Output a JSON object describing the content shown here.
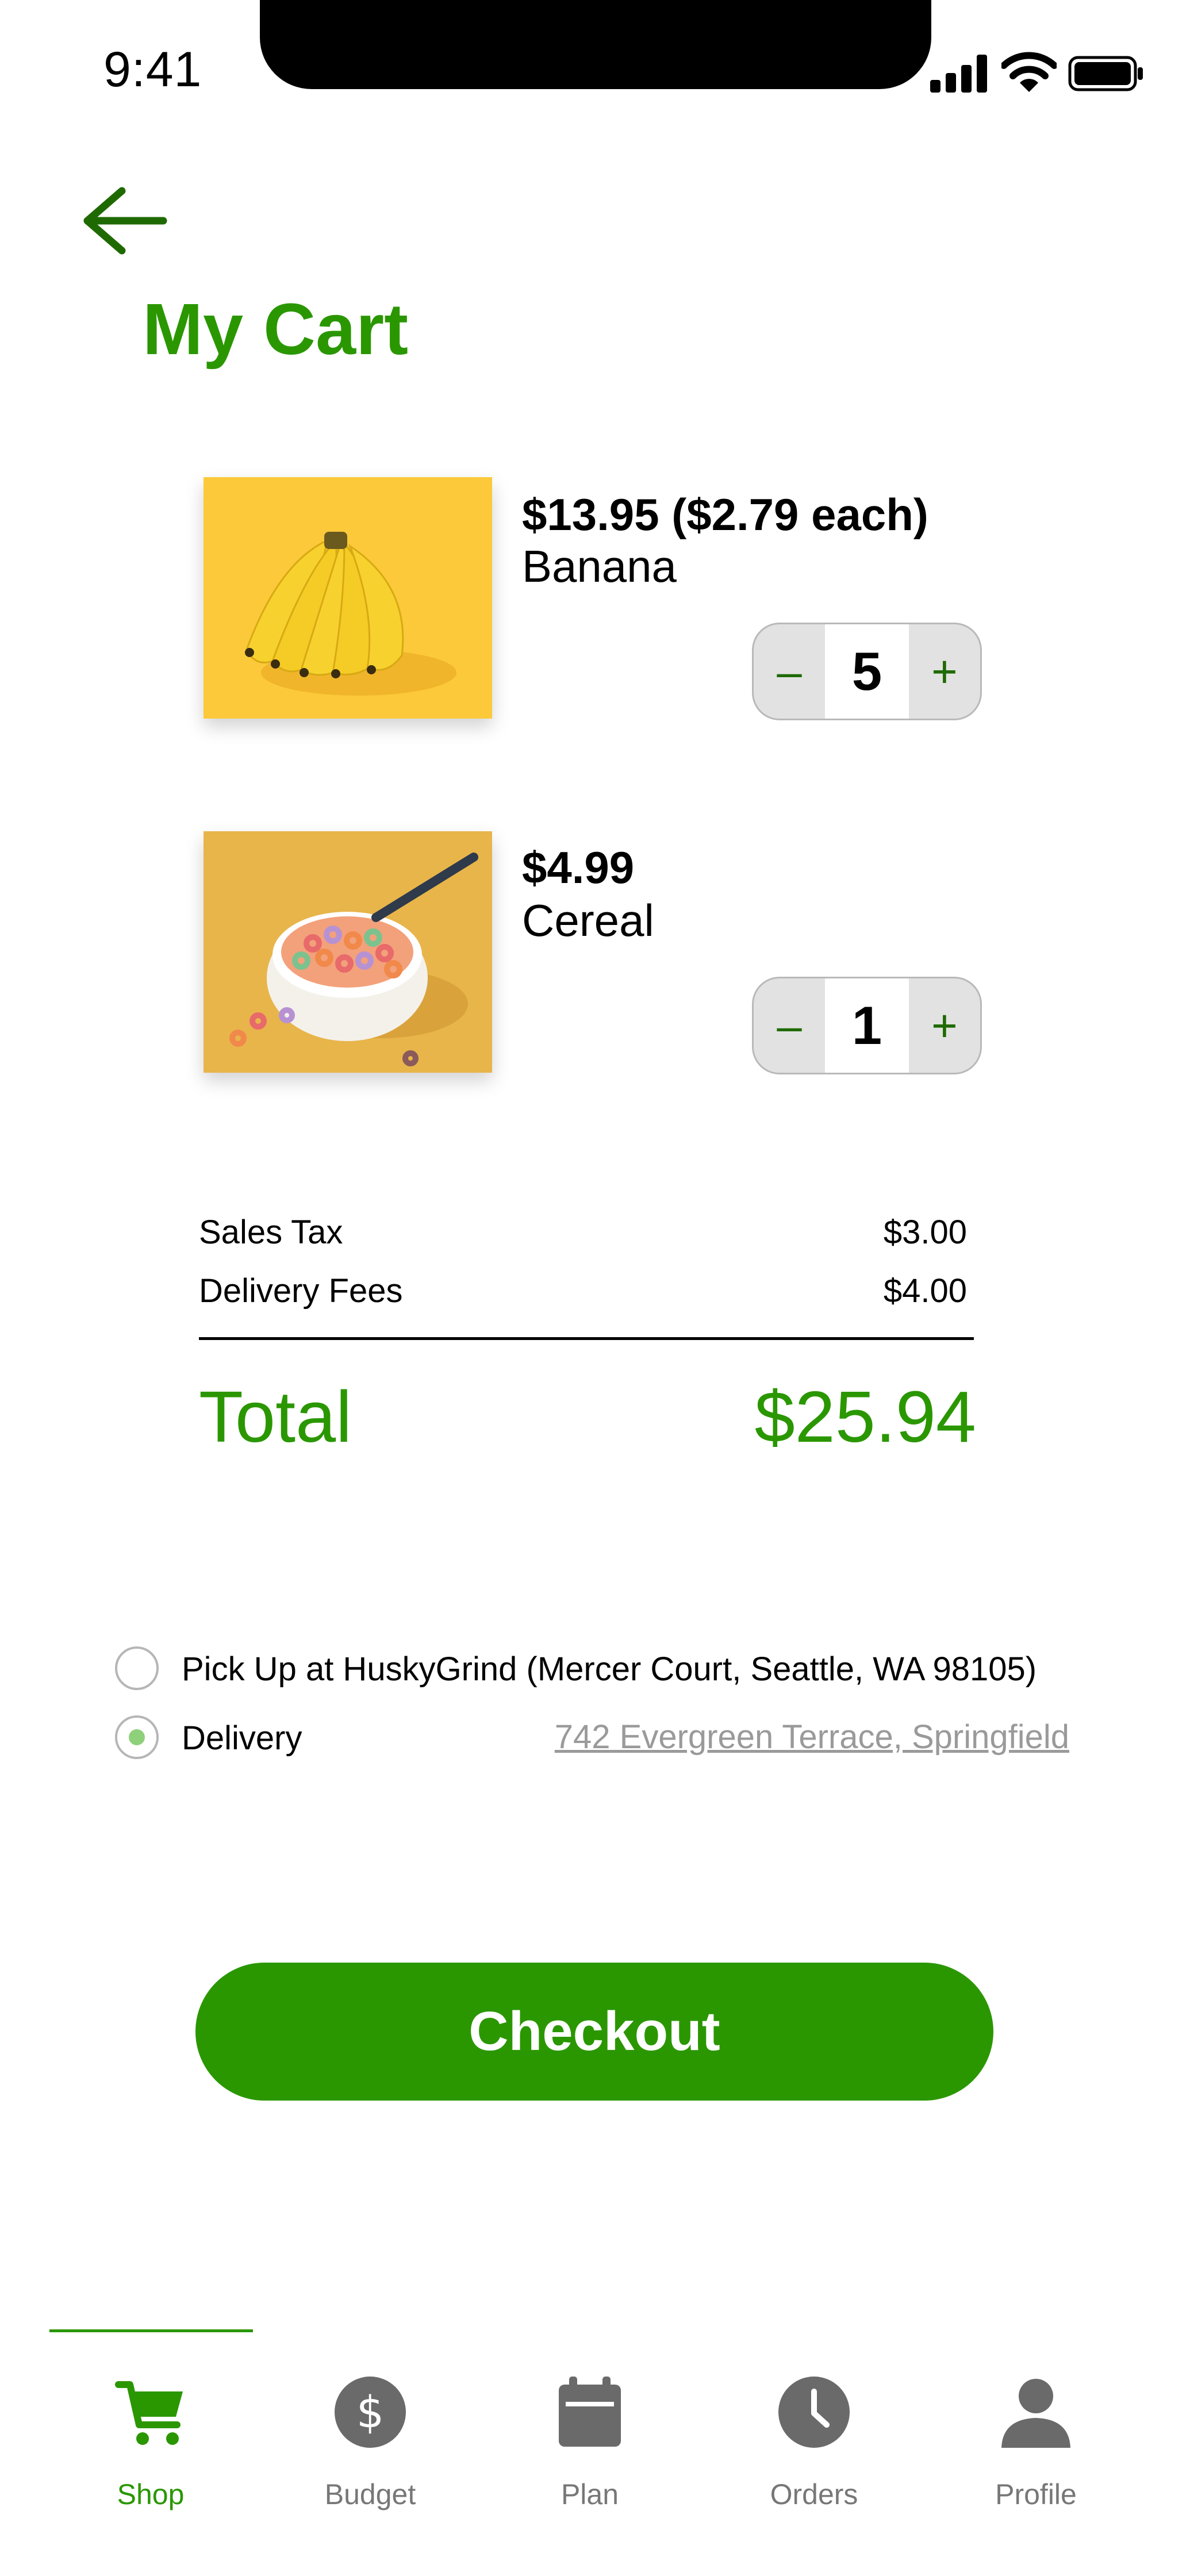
{
  "status_bar": {
    "time": "9:41"
  },
  "header": {
    "title": "My Cart"
  },
  "cart": {
    "items": [
      {
        "price": "$13.95 ($2.79 each)",
        "name": "Banana",
        "quantity": "5",
        "minus": "–",
        "plus": "+"
      },
      {
        "price": "$4.99",
        "name": "Cereal",
        "quantity": "1",
        "minus": "–",
        "plus": "+"
      }
    ]
  },
  "summary": {
    "sales_tax_label": "Sales Tax",
    "sales_tax_value": "$3.00",
    "delivery_fees_label": "Delivery Fees",
    "delivery_fees_value": "$4.00",
    "total_label": "Total",
    "total_value": "$25.94"
  },
  "fulfillment": {
    "pickup_label": "Pick Up at HuskyGrind (Mercer Court, Seattle, WA 98105)",
    "delivery_label": "Delivery",
    "delivery_address": "742 Evergreen Terrace, Springfield",
    "selected": "delivery"
  },
  "checkout_label": "Checkout",
  "tabs": [
    {
      "label": "Shop",
      "icon": "cart-icon",
      "active": true
    },
    {
      "label": "Budget",
      "icon": "dollar-icon",
      "active": false
    },
    {
      "label": "Plan",
      "icon": "calendar-icon",
      "active": false
    },
    {
      "label": "Orders",
      "icon": "clock-icon",
      "active": false
    },
    {
      "label": "Profile",
      "icon": "person-icon",
      "active": false
    }
  ],
  "colors": {
    "accent": "#2a9700",
    "inactive": "#777777",
    "icon_gray": "#6a6a6a"
  }
}
